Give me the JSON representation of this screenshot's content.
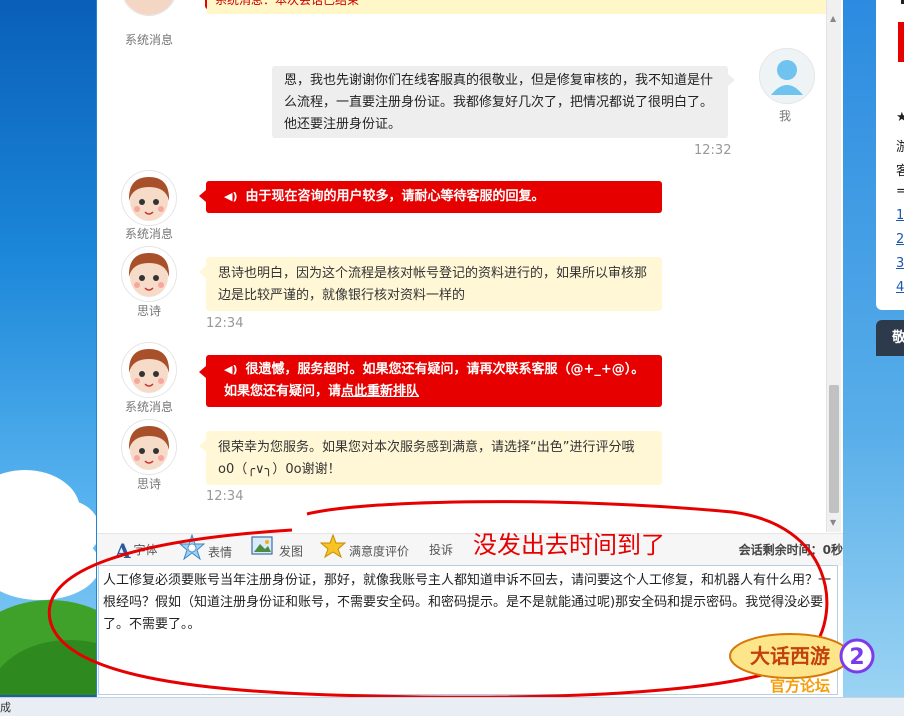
{
  "colors": {
    "accent_red": "#e60000",
    "agent_bubble": "#fff7d6",
    "user_bubble": "#eeeeee"
  },
  "top_notice": "系统消息：本次会话已结束",
  "messages": [
    {
      "from": "sys",
      "name": "系统消息",
      "text": ""
    },
    {
      "from": "user",
      "name": "我",
      "text": "恩，我也先谢谢你们在线客服真的很敬业，但是修复审核的，我不知道是什么流程，一直要注册身份证。我都修复好几次了，把情况都说了很明白了。他还要注册身份证。",
      "time": "12:32"
    },
    {
      "from": "sys",
      "name": "系统消息",
      "text": "由于现在咨询的用户较多，请耐心等待客服的回复。",
      "icon": "speaker-icon"
    },
    {
      "from": "agent",
      "name": "思诗",
      "text": "思诗也明白，因为这个流程是核对帐号登记的资料进行的，如果所以审核那边是比较严谨的，就像银行核对资料一样的",
      "time": "12:34"
    },
    {
      "from": "sys",
      "name": "系统消息",
      "text": "很遗憾，服务超时。如果您还有疑问，请再次联系客服（@+_+@）。 如果您还有疑问，请",
      "link": "点此重新排队",
      "icon": "speaker-icon"
    },
    {
      "from": "agent",
      "name": "思诗",
      "text": "很荣幸为您服务。如果您对本次服务感到满意，请选择“出色”进行评分哦o0（╭∨╮）0o谢谢！",
      "time": "12:34"
    }
  ],
  "toolbar": {
    "font_label": "字体",
    "emoji_label": "表情",
    "image_label": "发图",
    "rating_label": "满意度评价",
    "complain_label": "投诉",
    "session_time_label": "会话剩余时间：0秒"
  },
  "annotation": "没发出去时间到了",
  "input": {
    "value": "人工修复必须要账号当年注册身份证，那好，就像我账号主人都知道申诉不回去，请问要这个人工修复，和机器人有什么用？一根经吗？假如（知道注册身份证和账号，不需要安全码。和密码提示。是不是就能通过呢)那安全码和提示密码。我觉得没必要了。不需要了。。"
  },
  "side_panel": {
    "star": "★",
    "line1": "游",
    "line2": "客",
    "line3": "=",
    "items": [
      "1",
      "2",
      "3",
      "4"
    ],
    "header": "敬"
  },
  "logo_text": "大话西游2",
  "logo_sub": "官方论坛",
  "logo_url": "xyq.netease.com",
  "status_text": "成"
}
